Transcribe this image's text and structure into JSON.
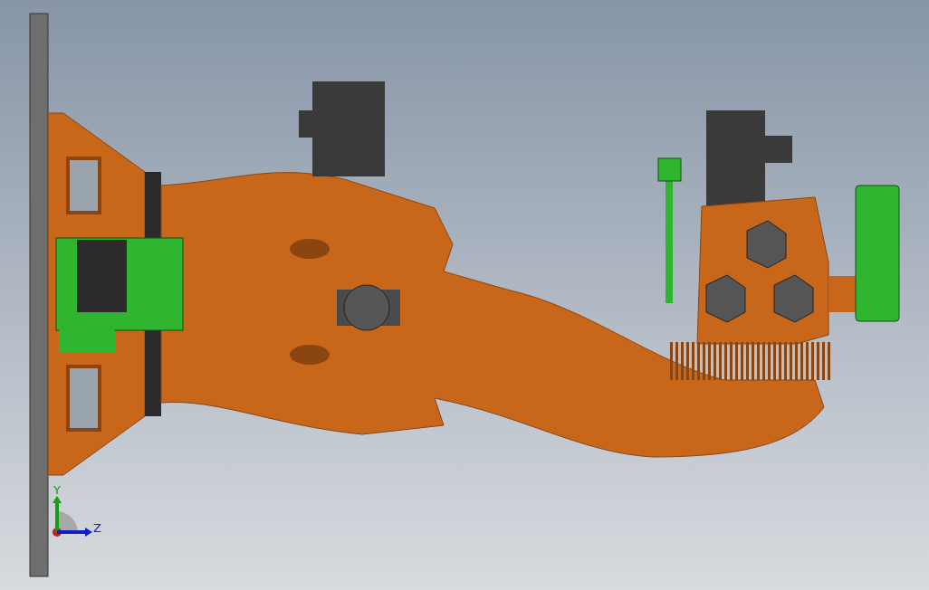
{
  "viewport": {
    "triad": {
      "axes": [
        {
          "label": "Y",
          "color": "#10a010"
        },
        {
          "label": "Z",
          "color": "#1020c0"
        }
      ]
    }
  }
}
